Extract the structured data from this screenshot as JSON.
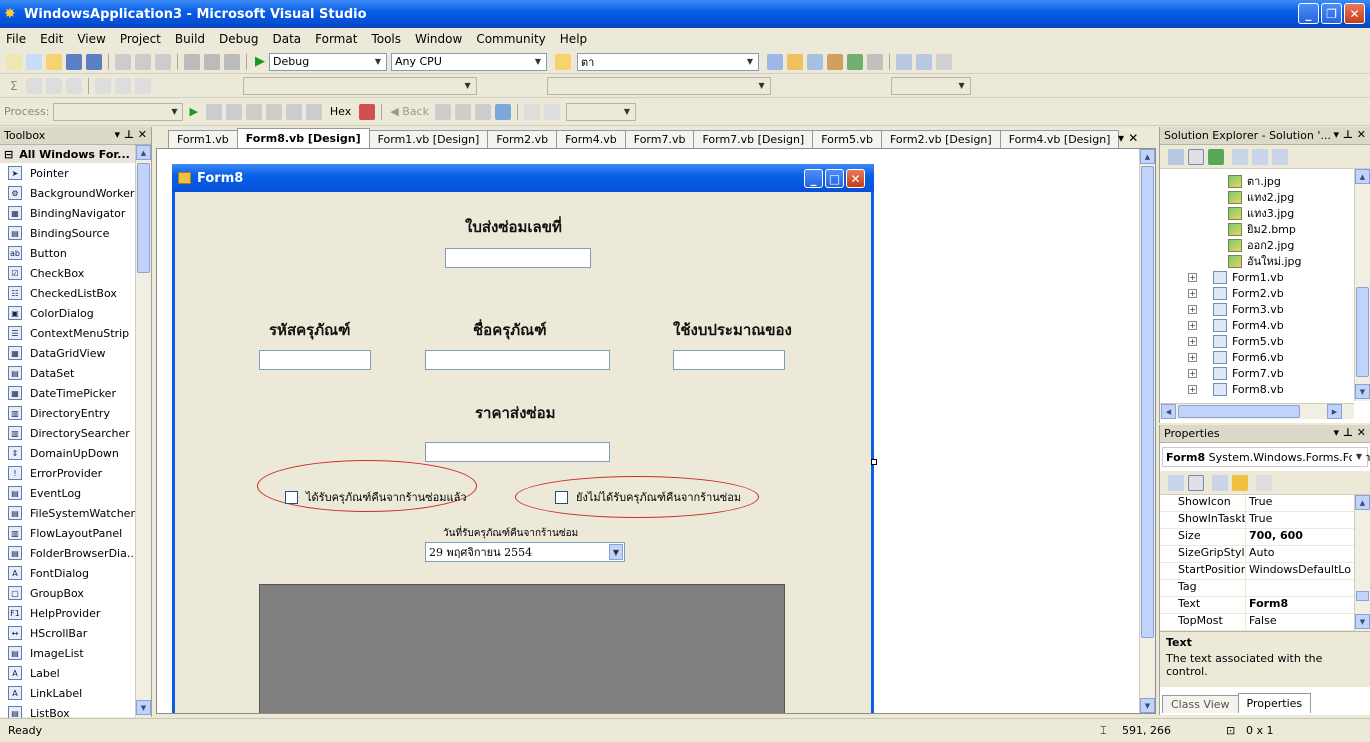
{
  "window": {
    "title": "WindowsApplication3 - Microsoft Visual Studio"
  },
  "menu": [
    "File",
    "Edit",
    "View",
    "Project",
    "Build",
    "Debug",
    "Data",
    "Format",
    "Tools",
    "Window",
    "Community",
    "Help"
  ],
  "toolbar": {
    "config": "Debug",
    "platform": "Any CPU",
    "find": "ตา",
    "process_label": "Process:",
    "hex": "Hex",
    "back": "Back"
  },
  "toolbox": {
    "title": "Toolbox",
    "group": "All Windows For...",
    "items": [
      "Pointer",
      "BackgroundWorker",
      "BindingNavigator",
      "BindingSource",
      "Button",
      "CheckBox",
      "CheckedListBox",
      "ColorDialog",
      "ContextMenuStrip",
      "DataGridView",
      "DataSet",
      "DateTimePicker",
      "DirectoryEntry",
      "DirectorySearcher",
      "DomainUpDown",
      "ErrorProvider",
      "EventLog",
      "FileSystemWatcher",
      "FlowLayoutPanel",
      "FolderBrowserDia...",
      "FontDialog",
      "GroupBox",
      "HelpProvider",
      "HScrollBar",
      "ImageList",
      "Label",
      "LinkLabel",
      "ListBox"
    ]
  },
  "tabs": [
    "Form1.vb",
    "Form8.vb [Design]",
    "Form1.vb [Design]",
    "Form2.vb",
    "Form4.vb",
    "Form7.vb",
    "Form7.vb [Design]",
    "Form5.vb",
    "Form2.vb [Design]",
    "Form4.vb [Design]"
  ],
  "form": {
    "title": "Form8",
    "heading": "ใบส่งซ่อมเลขที่",
    "label_code": "รหัสครุภัณฑ์",
    "label_name": "ชื่อครุภัณฑ์",
    "label_budget": "ใช้งบประมาณของ",
    "label_price": "ราคาส่งซ่อม",
    "check_received": "ได้รับครุภัณฑ์คืนจากร้านซ่อมแล้ว",
    "check_not_received": "ยังไม่ได้รับครุภัณฑ์คืนจากร้านซ่อม",
    "date_label": "วันที่รับครุภัณฑ์คืนจากร้านซ่อม",
    "date_value": "29 พฤศจิกายน  2554"
  },
  "solution_explorer": {
    "title": "Solution Explorer - Solution '...",
    "images": [
      "ตา.jpg",
      "แทง2.jpg",
      "แทง3.jpg",
      "ยิม2.bmp",
      "ออก2.jpg",
      "อันใหม่.jpg"
    ],
    "forms": [
      "Form1.vb",
      "Form2.vb",
      "Form3.vb",
      "Form4.vb",
      "Form5.vb",
      "Form6.vb",
      "Form7.vb",
      "Form8.vb"
    ]
  },
  "properties": {
    "title": "Properties",
    "object": "Form8",
    "object_type": "System.Windows.Forms.Form",
    "rows": [
      {
        "name": "ShowIcon",
        "value": "True"
      },
      {
        "name": "ShowInTaskbar",
        "value": "True"
      },
      {
        "name": "Size",
        "value": "700, 600"
      },
      {
        "name": "SizeGripStyle",
        "value": "Auto"
      },
      {
        "name": "StartPosition",
        "value": "WindowsDefaultLo"
      },
      {
        "name": "Tag",
        "value": ""
      },
      {
        "name": "Text",
        "value": "Form8"
      },
      {
        "name": "TopMost",
        "value": "False"
      }
    ],
    "desc_title": "Text",
    "desc_text": "The text associated with the control.",
    "tab_class": "Class View",
    "tab_props": "Properties"
  },
  "status": {
    "text": "Ready",
    "position": "591, 266",
    "size": "0 x 1"
  }
}
